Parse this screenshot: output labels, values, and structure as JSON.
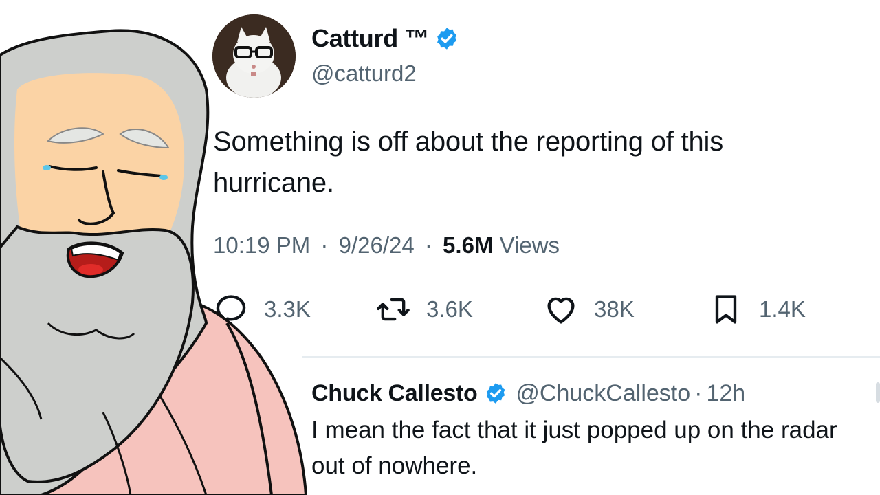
{
  "tweet": {
    "author_name": "Catturd ™",
    "author_handle": "@catturd2",
    "verified_icon": "verified-badge-icon",
    "text": "Something is off about the reporting of this hurricane.",
    "time": "10:19 PM",
    "date": "9/26/24",
    "views_count": "5.6M",
    "views_label": "Views",
    "separator": "·",
    "actions": {
      "replies": "3.3K",
      "retweets": "3.6K",
      "likes": "38K",
      "bookmarks": "1.4K"
    }
  },
  "reply": {
    "author_name": "Chuck Callesto",
    "author_handle": "@ChuckCallesto",
    "separator": "·",
    "time": "12h",
    "text": "I mean the fact that it just popped up on the radar out of nowhere."
  },
  "colors": {
    "text_primary": "#0f1419",
    "text_secondary": "#536471",
    "verified_blue": "#1d9bf0",
    "divider": "#e6ecf0",
    "cartoon_skin": "#fbd3a5",
    "cartoon_hair": "#cdcfcc",
    "cartoon_shirt": "#f5c2bd"
  }
}
